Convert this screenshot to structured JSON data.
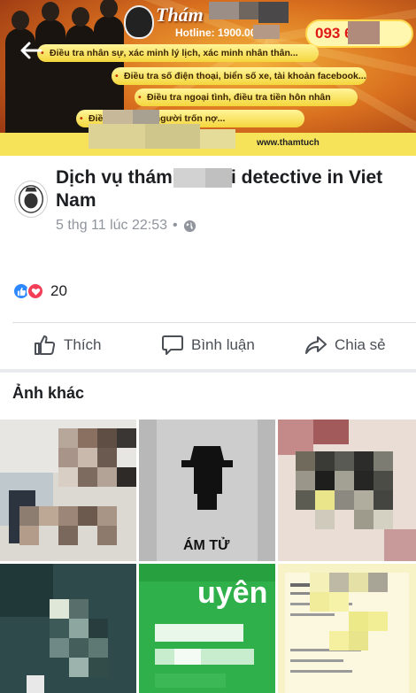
{
  "banner": {
    "brand": "Thám",
    "hotline": "Hotline: 1900.00",
    "phone": "093        666",
    "services": [
      "Điều tra nhân sự, xác minh lý lịch, xác minh nhân thân...",
      "Điều tra số điện thoại, biển số xe, tài khoản facebook...",
      "Điều tra ngoại tình, điều tra tiền hôn nhân",
      "Điều                tài chính, người trốn nợ..."
    ],
    "website": "www.thamtuch"
  },
  "post": {
    "page_title": "Dịch vụ thám         i - Tuki detective in Viet Nam",
    "timestamp": "5 thg 11 lúc 22:53",
    "separator": "•",
    "reaction_count": "20"
  },
  "actions": {
    "like": "Thích",
    "comment": "Bình luận",
    "share": "Chia sẻ"
  },
  "other_photos": {
    "title": "Ảnh khác",
    "photo2_caption": "ÁM TỬ",
    "photo5_caption": "uyên"
  },
  "colors": {
    "facebook_blue": "#2d88ff",
    "love_red": "#f33e58",
    "banner_orange": "#d9701f",
    "banner_yellow": "#f6e35a",
    "photo_green": "#2fb04a"
  },
  "icons": [
    "back-arrow-icon",
    "globe-icon",
    "like-thumb-icon",
    "comment-bubble-icon",
    "share-arrow-icon",
    "like-reaction-icon",
    "love-reaction-icon"
  ]
}
